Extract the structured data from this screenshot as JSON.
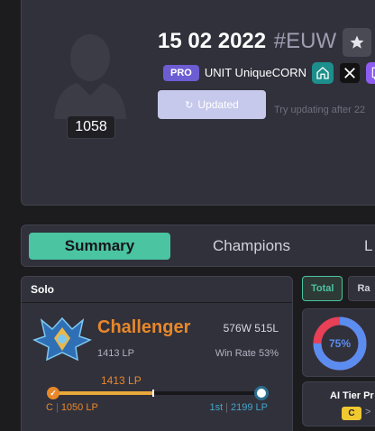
{
  "profile": {
    "level": "1058",
    "summoner_name": "15 02 2022",
    "tagline": "#EUW",
    "pro_badge": "PRO",
    "team_name": "UNIT UniqueCORN",
    "update_button": "Updated",
    "update_hint": "Try updating after 22"
  },
  "tabs": {
    "summary": "Summary",
    "champions": "Champions",
    "live": "L"
  },
  "ranked": {
    "queue": "Solo",
    "tier": "Challenger",
    "record": "576W 515L",
    "lp": "1413 LP",
    "win_rate": "Win Rate 53%",
    "progress_label": "1413 LP",
    "progress_fraction": 0.48,
    "start_grade": "C",
    "start_lp": "1050 LP",
    "end_rank": "1st",
    "end_lp": "2199 LP"
  },
  "stats": {
    "tab_total": "Total",
    "tab_ranked": "Ra",
    "win_rate_percent": 75,
    "win_rate_text": "75%",
    "ai_tier_title": "AI Tier Pr",
    "ai_grade": "C",
    "ai_arrow": ">"
  },
  "colors": {
    "accent": "#4ac4a1",
    "challenger": "#e8882a",
    "win": "#5b8df0",
    "loss": "#e84057",
    "pro": "#6c5dd3"
  }
}
